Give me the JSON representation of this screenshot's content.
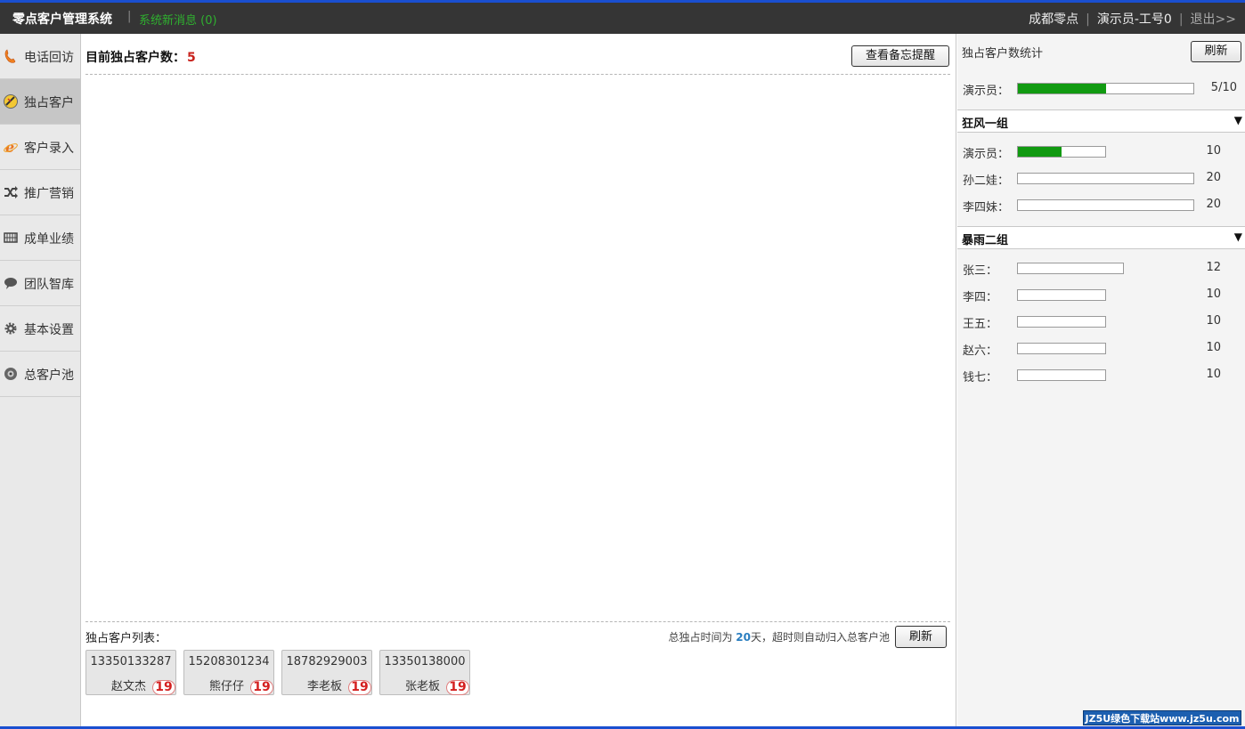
{
  "header": {
    "app_title": "零点客户管理系统",
    "separator": "|",
    "messages_label": "系统新消息",
    "messages_count": "(0)",
    "location": "成都零点",
    "user": "演示员-工号0",
    "logout": "退出>>"
  },
  "sidebar": {
    "items": [
      {
        "label": "电话回访",
        "icon": "phone-icon"
      },
      {
        "label": "独占客户",
        "icon": "exclusive-client-icon",
        "active": true
      },
      {
        "label": "客户录入",
        "icon": "ie-icon"
      },
      {
        "label": "推广营销",
        "icon": "shuffle-icon"
      },
      {
        "label": "成单业绩",
        "icon": "grid-icon"
      },
      {
        "label": "团队智库",
        "icon": "chat-icon"
      },
      {
        "label": "基本设置",
        "icon": "gear-icon"
      },
      {
        "label": "总客户池",
        "icon": "pool-icon"
      }
    ]
  },
  "main": {
    "count_label": "目前独占客户数：",
    "count_value": "5",
    "memo_button": "查看备忘提醒",
    "list_label": "独占客户列表：",
    "notice_prefix": "总独占时间为",
    "notice_days": "20",
    "notice_suffix": "天，超时则自动归入总客户池",
    "refresh_button": "刷新",
    "customers": [
      {
        "phone": "13350133287",
        "name": "赵文杰",
        "days": "19"
      },
      {
        "phone": "15208301234",
        "name": "熊仔仔",
        "days": "19"
      },
      {
        "phone": "18782929003",
        "name": "李老板",
        "days": "19"
      },
      {
        "phone": "13350138000",
        "name": "张老板",
        "days": "19"
      }
    ]
  },
  "right_panel": {
    "title": "独占客户数统计",
    "refresh_button": "刷新",
    "self": {
      "name": "演示员：",
      "value": "5/10",
      "fill": 0.5
    },
    "groups": [
      {
        "name": "狂风一组",
        "arrow": "▼",
        "members": [
          {
            "name": "演示员：",
            "value": "10",
            "fill": 0.5
          },
          {
            "name": "孙二娃：",
            "value": "20",
            "fill": 0
          },
          {
            "name": "李四妹：",
            "value": "20",
            "fill": 0
          }
        ]
      },
      {
        "name": "暴雨二组",
        "arrow": "▼",
        "members": [
          {
            "name": "张三：",
            "value": "12",
            "fill": 0
          },
          {
            "name": "李四：",
            "value": "10",
            "fill": 0
          },
          {
            "name": "王五：",
            "value": "10",
            "fill": 0
          },
          {
            "name": "赵六：",
            "value": "10",
            "fill": 0
          },
          {
            "name": "钱七：",
            "value": "10",
            "fill": 0
          }
        ]
      }
    ]
  },
  "watermark": "JZ5U绿色下载站www.jz5u.com",
  "colors": {
    "accent_blue": "#1a4fd0",
    "bar_fill": "#119a11",
    "count_red": "#c8221c",
    "message_green": "#2fb02f"
  }
}
